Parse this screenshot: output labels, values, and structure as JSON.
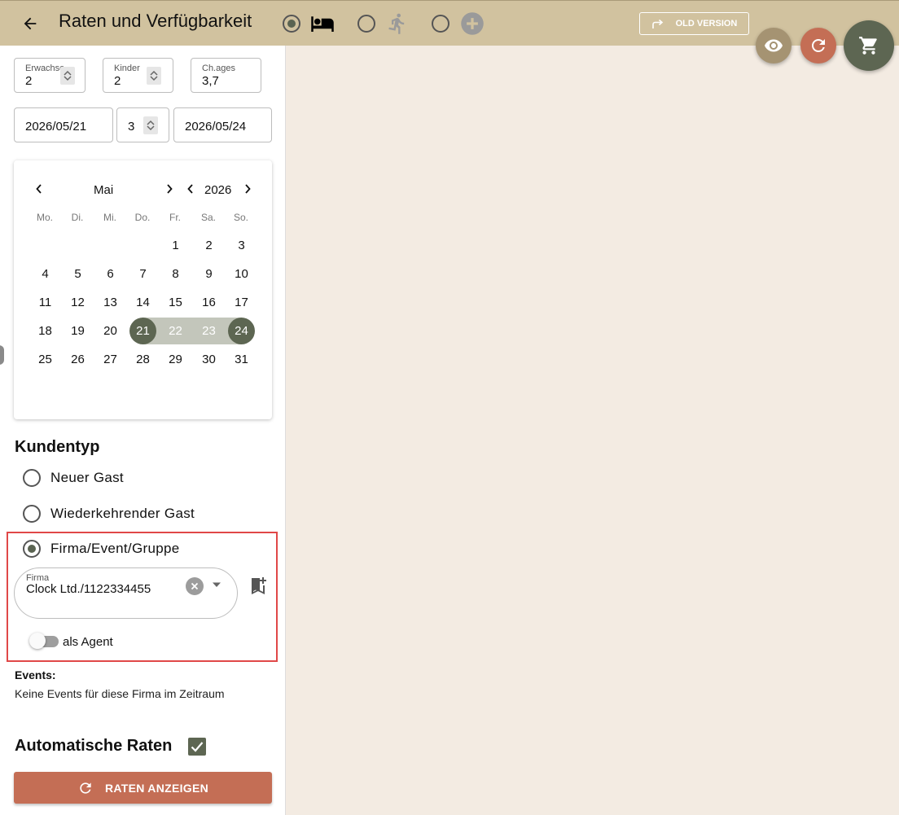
{
  "header": {
    "title": "Raten und Verfügbarkeit",
    "old_version_label": "OLD VERSION",
    "modes": [
      {
        "icon": "bed-icon",
        "checked": true
      },
      {
        "icon": "walking-person-icon",
        "checked": false
      },
      {
        "icon": "plus-circle-icon",
        "checked": false
      }
    ]
  },
  "guests": {
    "adults_label": "Erwachse...",
    "adults_value": "2",
    "children_label": "Kinder",
    "children_value": "2",
    "child_ages_label": "Ch.ages",
    "child_ages_value": "3,7"
  },
  "dates": {
    "arrival": "2026/05/21",
    "nights": "3",
    "departure": "2026/05/24"
  },
  "calendar": {
    "month": "Mai",
    "year": "2026",
    "weekdays": [
      "Mo.",
      "Di.",
      "Mi.",
      "Do.",
      "Fr.",
      "Sa.",
      "So."
    ],
    "first_weekday_index": 4,
    "days_in_month": 31,
    "range_start": 21,
    "range_end": 24
  },
  "customer_type": {
    "title": "Kundentyp",
    "options": [
      "Neuer Gast",
      "Wiederkehrender Gast",
      "Firma/Event/Gruppe"
    ],
    "selected_index": 2,
    "company_label": "Firma",
    "company_value": "Clock Ltd./1122334455",
    "agent_label": "als Agent",
    "agent_on": false
  },
  "events": {
    "title": "Events:",
    "text": "Keine Events für diese Firma im Zeitraum"
  },
  "auto_rates": {
    "label": "Automatische Raten",
    "checked": true
  },
  "show_rates_button": "RATEN ANZEIGEN",
  "colors": {
    "header_bg": "#d1c29f",
    "accent_green": "#5d6652",
    "accent_red": "#c46e55",
    "page_bg": "#f3ebe2"
  }
}
